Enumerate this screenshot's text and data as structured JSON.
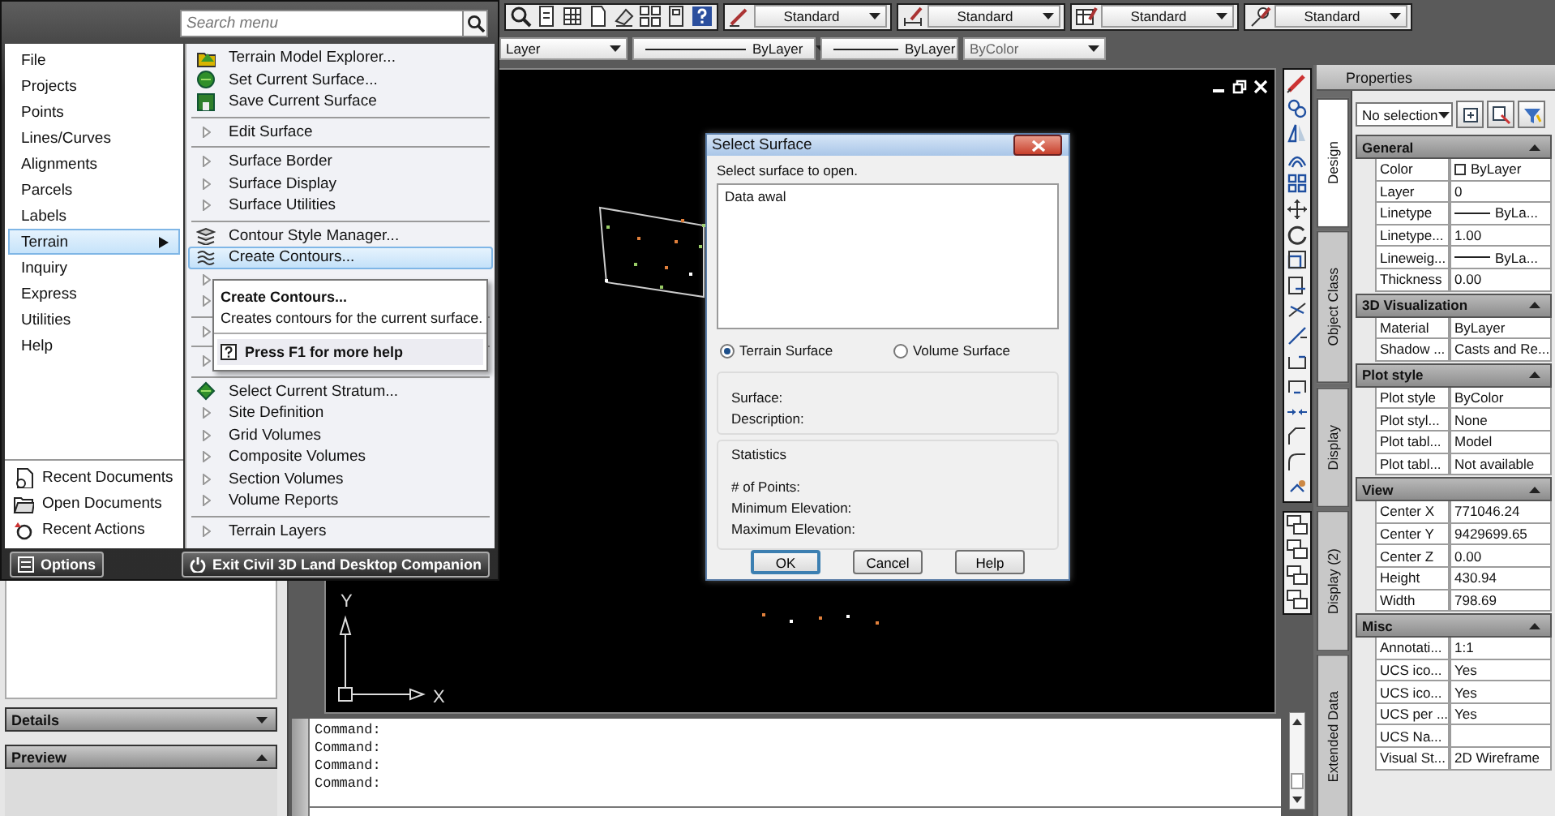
{
  "toolbars": {
    "style_dropdowns": [
      {
        "value": "Standard"
      },
      {
        "value": "Standard"
      },
      {
        "value": "Standard"
      },
      {
        "value": "Standard"
      }
    ],
    "layer_dropdowns": [
      {
        "kind": "plain",
        "value": "Layer",
        "disabled": false
      },
      {
        "kind": "linetype",
        "value": "ByLayer",
        "disabled": false
      },
      {
        "kind": "lineweight",
        "value": "ByLayer",
        "disabled": false
      },
      {
        "kind": "plain",
        "value": "ByColor",
        "disabled": true
      }
    ]
  },
  "menu": {
    "search": {
      "placeholder": "Search menu"
    },
    "categories": [
      {
        "label": "File",
        "selected": false
      },
      {
        "label": "Projects",
        "selected": false
      },
      {
        "label": "Points",
        "selected": false
      },
      {
        "label": "Lines/Curves",
        "selected": false
      },
      {
        "label": "Alignments",
        "selected": false
      },
      {
        "label": "Parcels",
        "selected": false
      },
      {
        "label": "Labels",
        "selected": false
      },
      {
        "label": "Terrain",
        "selected": true
      },
      {
        "label": "Inquiry",
        "selected": false
      },
      {
        "label": "Express",
        "selected": false
      },
      {
        "label": "Utilities",
        "selected": false
      },
      {
        "label": "Help",
        "selected": false
      }
    ],
    "recent": [
      {
        "label": "Recent Documents"
      },
      {
        "label": "Open Documents"
      },
      {
        "label": "Recent Actions"
      }
    ],
    "items": [
      {
        "kind": "command",
        "label": "Terrain Model Explorer...",
        "selected": false
      },
      {
        "kind": "command",
        "label": "Set Current Surface...",
        "selected": false
      },
      {
        "kind": "command",
        "label": "Save Current Surface",
        "selected": false
      },
      {
        "kind": "separator"
      },
      {
        "kind": "submenu",
        "label": "Edit Surface",
        "selected": false
      },
      {
        "kind": "separator"
      },
      {
        "kind": "submenu",
        "label": "Surface Border",
        "selected": false
      },
      {
        "kind": "submenu",
        "label": "Surface Display",
        "selected": false
      },
      {
        "kind": "submenu",
        "label": "Surface Utilities",
        "selected": false
      },
      {
        "kind": "separator"
      },
      {
        "kind": "command",
        "label": "Contour Style Manager...",
        "selected": false
      },
      {
        "kind": "command",
        "label": "Create Contours...",
        "selected": true
      },
      {
        "kind": "submenu",
        "selected": false
      },
      {
        "kind": "submenu",
        "selected": false
      },
      {
        "kind": "separator"
      },
      {
        "kind": "submenu",
        "selected": false
      },
      {
        "kind": "separator"
      },
      {
        "kind": "submenu",
        "selected": false
      },
      {
        "kind": "separator"
      },
      {
        "kind": "command",
        "label": "Select Current Stratum...",
        "selected": false
      },
      {
        "kind": "submenu",
        "label": "Site Definition",
        "selected": false
      },
      {
        "kind": "submenu",
        "label": "Grid Volumes",
        "selected": false
      },
      {
        "kind": "submenu",
        "label": "Composite Volumes",
        "selected": false
      },
      {
        "kind": "submenu",
        "label": "Section Volumes",
        "selected": false
      },
      {
        "kind": "submenu",
        "label": "Volume Reports",
        "selected": false
      },
      {
        "kind": "separator"
      },
      {
        "kind": "submenu",
        "label": "Terrain Layers",
        "selected": false
      }
    ],
    "tooltip": {
      "title": "Create Contours...",
      "description": "Creates contours for the current surface.",
      "help": "Press F1 for more help"
    },
    "options_button": "Options",
    "exit_button": "Exit Civil 3D Land Desktop Companion"
  },
  "drawing": {
    "axis_y": "Y",
    "axis_x": "X"
  },
  "dialog": {
    "title": "Select Surface",
    "prompt": "Select surface to open.",
    "surfaces": [
      {
        "label": "Data awal",
        "selected": false
      }
    ],
    "surface_types": [
      {
        "label": "Terrain Surface",
        "selected": true
      },
      {
        "label": "Volume Surface",
        "selected": false
      }
    ],
    "info_fields": [
      "Surface:",
      "Description:"
    ],
    "statistics": {
      "title": "Statistics",
      "fields": [
        "# of Points:",
        "Minimum Elevation:",
        "Maximum Elevation:"
      ]
    },
    "buttons": [
      {
        "label": "OK",
        "default": true
      },
      {
        "label": "Cancel",
        "default": false
      },
      {
        "label": "Help",
        "default": false
      }
    ]
  },
  "left_panel": {
    "sections": [
      {
        "title": "Details",
        "expanded": false
      },
      {
        "title": "Preview",
        "expanded": true
      }
    ]
  },
  "command_line": {
    "lines": [
      "Command:",
      "Command:",
      "Command:",
      "Command:"
    ]
  },
  "properties": {
    "title": "Properties",
    "selection": "No selection",
    "tabs": [
      {
        "label": "Design",
        "selected": true
      },
      {
        "label": "Object Class",
        "selected": false
      },
      {
        "label": "Display",
        "selected": false
      },
      {
        "label": "Display (2)",
        "selected": false
      },
      {
        "label": "Extended Data",
        "selected": false
      }
    ],
    "sections": [
      {
        "title": "General",
        "expanded": true,
        "rows": [
          {
            "kind": "color",
            "name": "Color",
            "value": "ByLayer"
          },
          {
            "kind": "text",
            "name": "Layer",
            "value": "0"
          },
          {
            "kind": "line",
            "name": "Linetype",
            "value": "ByLa..."
          },
          {
            "kind": "text",
            "name": "Linetype...",
            "value": "1.00"
          },
          {
            "kind": "line",
            "name": "Lineweig...",
            "value": "ByLa..."
          },
          {
            "kind": "text",
            "name": "Thickness",
            "value": "0.00"
          }
        ]
      },
      {
        "title": "3D Visualization",
        "expanded": true,
        "rows": [
          {
            "kind": "text",
            "name": "Material",
            "value": "ByLayer"
          },
          {
            "kind": "text",
            "name": "Shadow ...",
            "value": "Casts and Re..."
          }
        ]
      },
      {
        "title": "Plot style",
        "expanded": true,
        "rows": [
          {
            "kind": "text",
            "name": "Plot style",
            "value": "ByColor"
          },
          {
            "kind": "text",
            "name": "Plot styl...",
            "value": "None"
          },
          {
            "kind": "text",
            "name": "Plot tabl...",
            "value": "Model"
          },
          {
            "kind": "text",
            "name": "Plot tabl...",
            "value": "Not available"
          }
        ]
      },
      {
        "title": "View",
        "expanded": true,
        "rows": [
          {
            "kind": "text",
            "name": "Center X",
            "value": "771046.24"
          },
          {
            "kind": "text",
            "name": "Center Y",
            "value": "9429699.65"
          },
          {
            "kind": "text",
            "name": "Center Z",
            "value": "0.00"
          },
          {
            "kind": "text",
            "name": "Height",
            "value": "430.94"
          },
          {
            "kind": "text",
            "name": "Width",
            "value": "798.69"
          }
        ]
      },
      {
        "title": "Misc",
        "expanded": true,
        "rows": [
          {
            "kind": "text",
            "name": "Annotati...",
            "value": "1:1"
          },
          {
            "kind": "text",
            "name": "UCS ico...",
            "value": "Yes"
          },
          {
            "kind": "text",
            "name": "UCS ico...",
            "value": "Yes"
          },
          {
            "kind": "text",
            "name": "UCS per ...",
            "value": "Yes"
          },
          {
            "kind": "text",
            "name": "UCS Na..."
          },
          {
            "kind": "text",
            "name": "Visual St...",
            "value": "2D Wireframe"
          }
        ]
      }
    ]
  }
}
